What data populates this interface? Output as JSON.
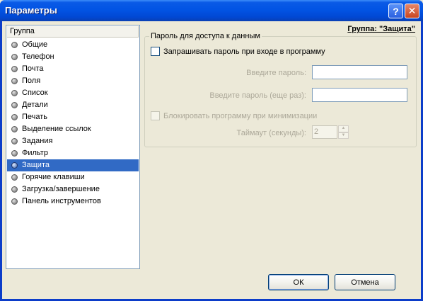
{
  "window": {
    "title": "Параметры"
  },
  "titlebar": {
    "help": "?",
    "close": "✕"
  },
  "list": {
    "header": "Группа",
    "items": [
      {
        "label": "Общие"
      },
      {
        "label": "Телефон"
      },
      {
        "label": "Почта"
      },
      {
        "label": "Поля"
      },
      {
        "label": "Список"
      },
      {
        "label": "Детали"
      },
      {
        "label": "Печать"
      },
      {
        "label": "Выделение ссылок"
      },
      {
        "label": "Задания"
      },
      {
        "label": "Фильтр"
      },
      {
        "label": "Защита",
        "selected": true
      },
      {
        "label": "Горячие клавиши"
      },
      {
        "label": "Загрузка/завершение"
      },
      {
        "label": "Панель инструментов"
      }
    ]
  },
  "group_title": "Группа: \"Защита\"",
  "password_group": {
    "legend": "Пароль для доступа к данным",
    "ask_password_label": "Запрашивать пароль при входе в программу",
    "ask_password_checked": false,
    "enter_password_label": "Введите пароль:",
    "enter_password_value": "",
    "enter_password_again_label": "Введите пароль (еще раз):",
    "enter_password_again_value": "",
    "lock_on_minimize_label": "Блокировать программу при минимизации",
    "lock_on_minimize_checked": false,
    "timeout_label": "Таймаут (секунды):",
    "timeout_value": "2"
  },
  "buttons": {
    "ok": "ОК",
    "cancel": "Отмена"
  }
}
